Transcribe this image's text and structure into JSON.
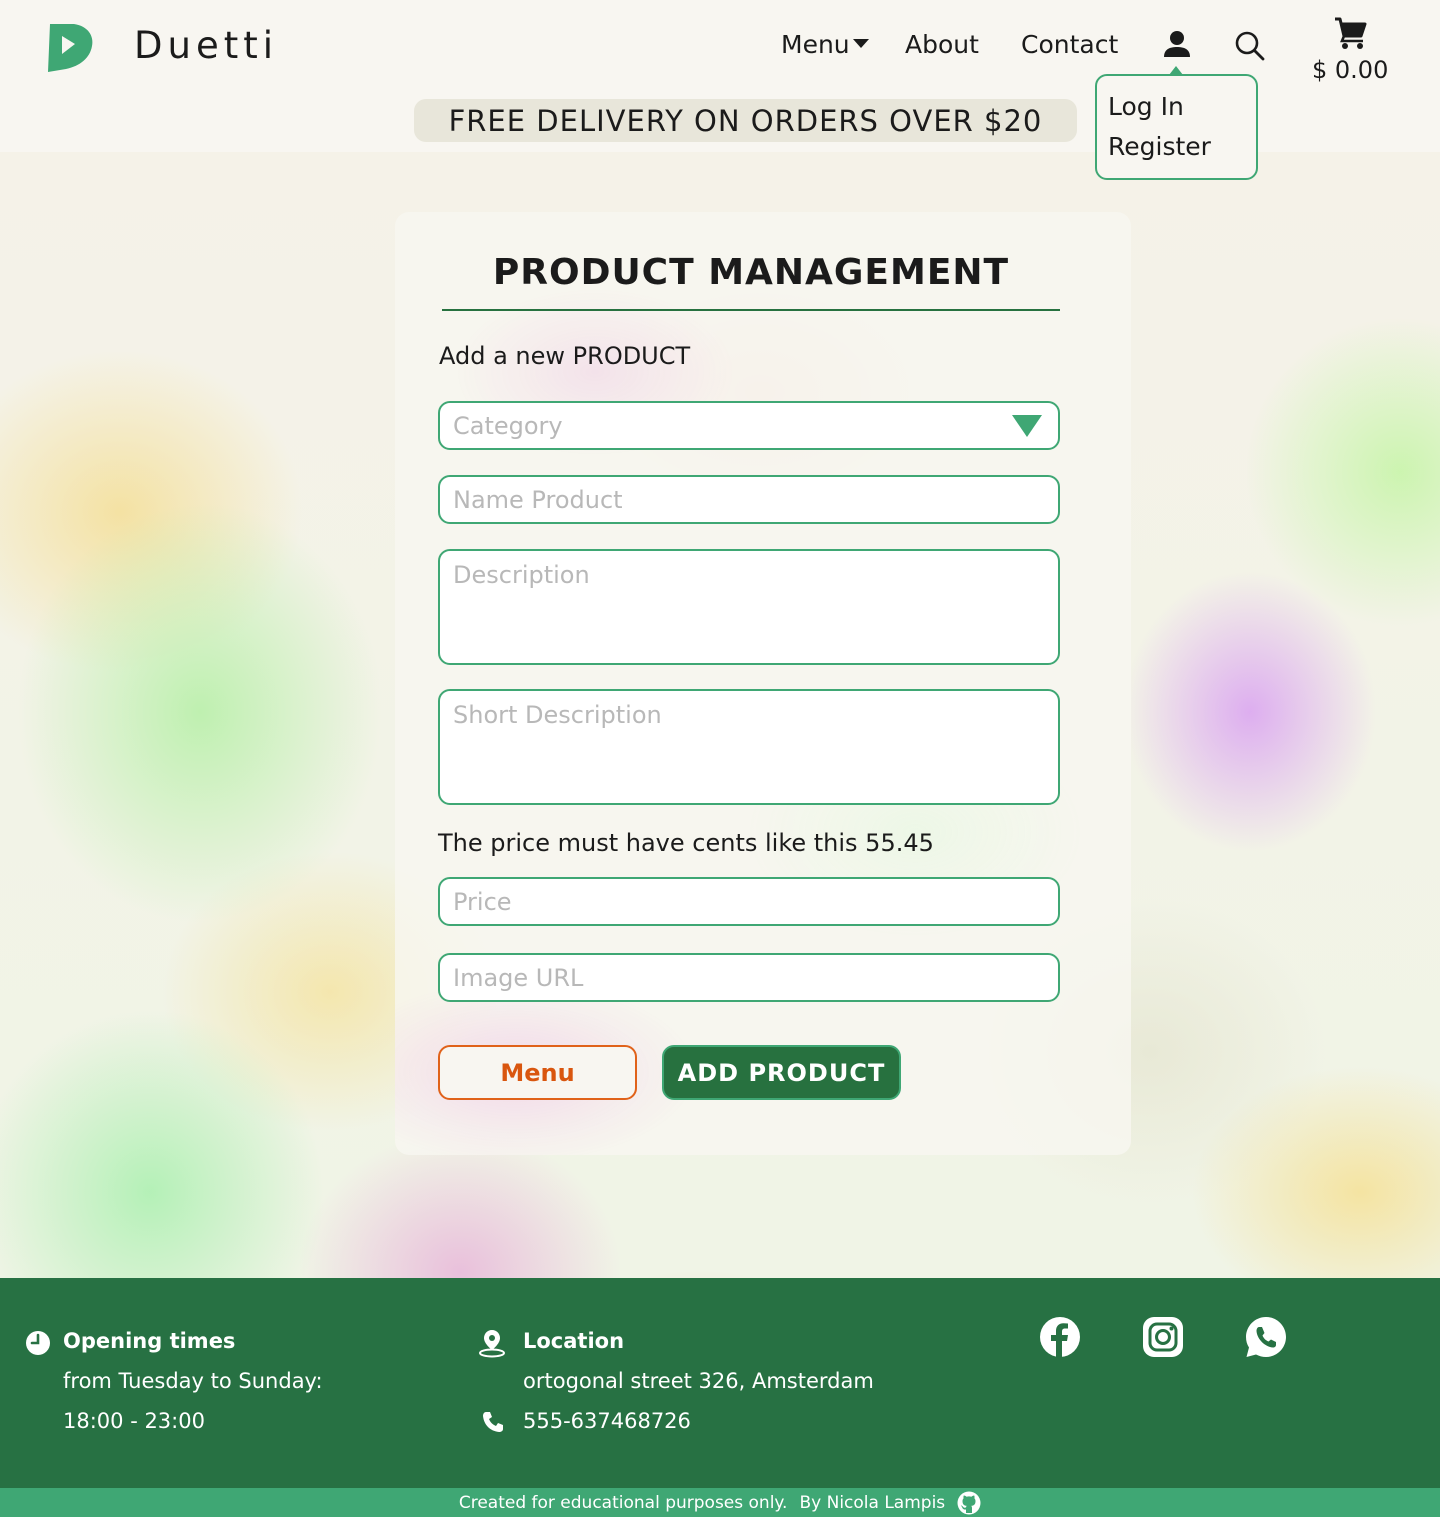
{
  "header": {
    "brand": "Duetti",
    "nav": {
      "menu": "Menu",
      "about": "About",
      "contact": "Contact"
    },
    "icons": {
      "user": "user-icon",
      "search": "search-icon",
      "cart": "cart-icon"
    },
    "cart_total": "$ 0.00",
    "promo": "FREE DELIVERY ON ORDERS OVER $20",
    "user_menu": {
      "login": "Log In",
      "register": "Register"
    }
  },
  "form": {
    "title": "PRODUCT MANAGEMENT",
    "subtitle": "Add a new PRODUCT",
    "category_placeholder": "Category",
    "name_placeholder": "Name Product",
    "description_placeholder": "Description",
    "short_description_placeholder": "Short Description",
    "price_hint": "The price must have cents like this 55.45",
    "price_placeholder": "Price",
    "image_url_placeholder": "Image URL",
    "menu_button": "Menu",
    "add_button": "ADD PRODUCT"
  },
  "footer": {
    "opening_title": "Opening times",
    "opening_days": "from Tuesday to Sunday:",
    "opening_hours": "18:00 - 23:00",
    "location_title": "Location",
    "address": "ortogonal street 326, Amsterdam",
    "phone": "555-637468726",
    "social": [
      "facebook-icon",
      "instagram-icon",
      "whatsapp-icon"
    ],
    "credits": "Created for educational purposes only.",
    "author": "By Nicola Lampis"
  },
  "colors": {
    "brand_green": "#3fa774",
    "dark_green": "#277143",
    "accent_orange": "#e0621a",
    "background": "#f8f6f1"
  }
}
